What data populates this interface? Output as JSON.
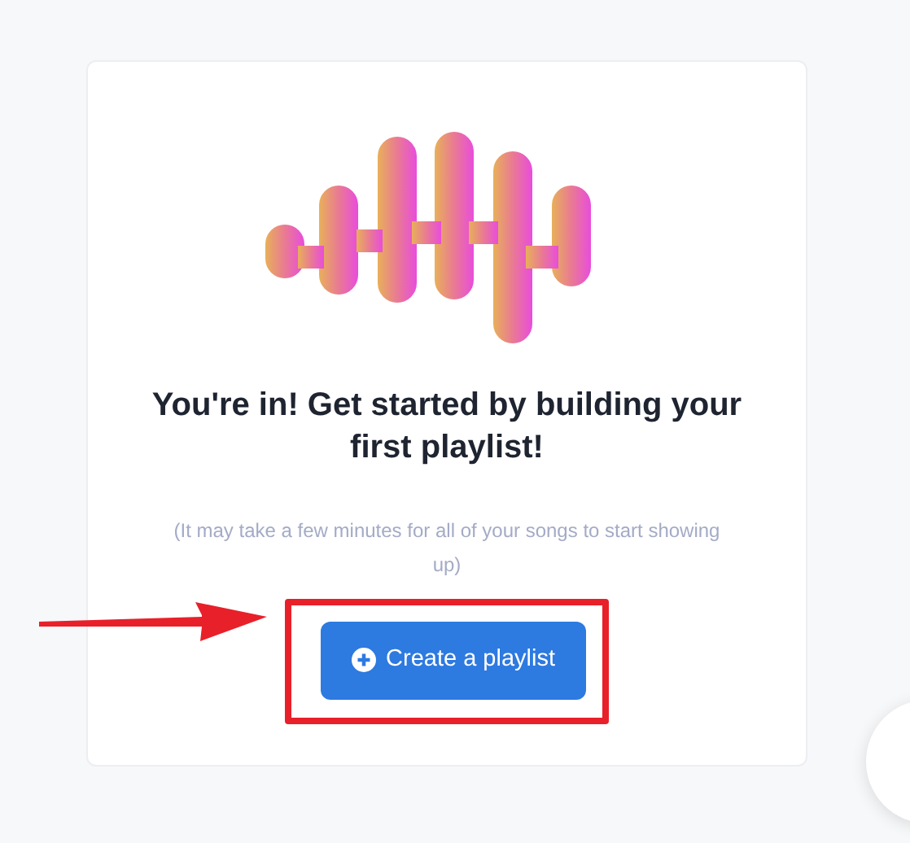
{
  "card": {
    "heading": "You're in! Get started by building your first playlist!",
    "note": "(It may take a few minutes for all of your songs to start showing up)",
    "button": {
      "label": "Create a playlist"
    }
  },
  "annotation": {
    "kind": "highlight_with_arrow"
  }
}
